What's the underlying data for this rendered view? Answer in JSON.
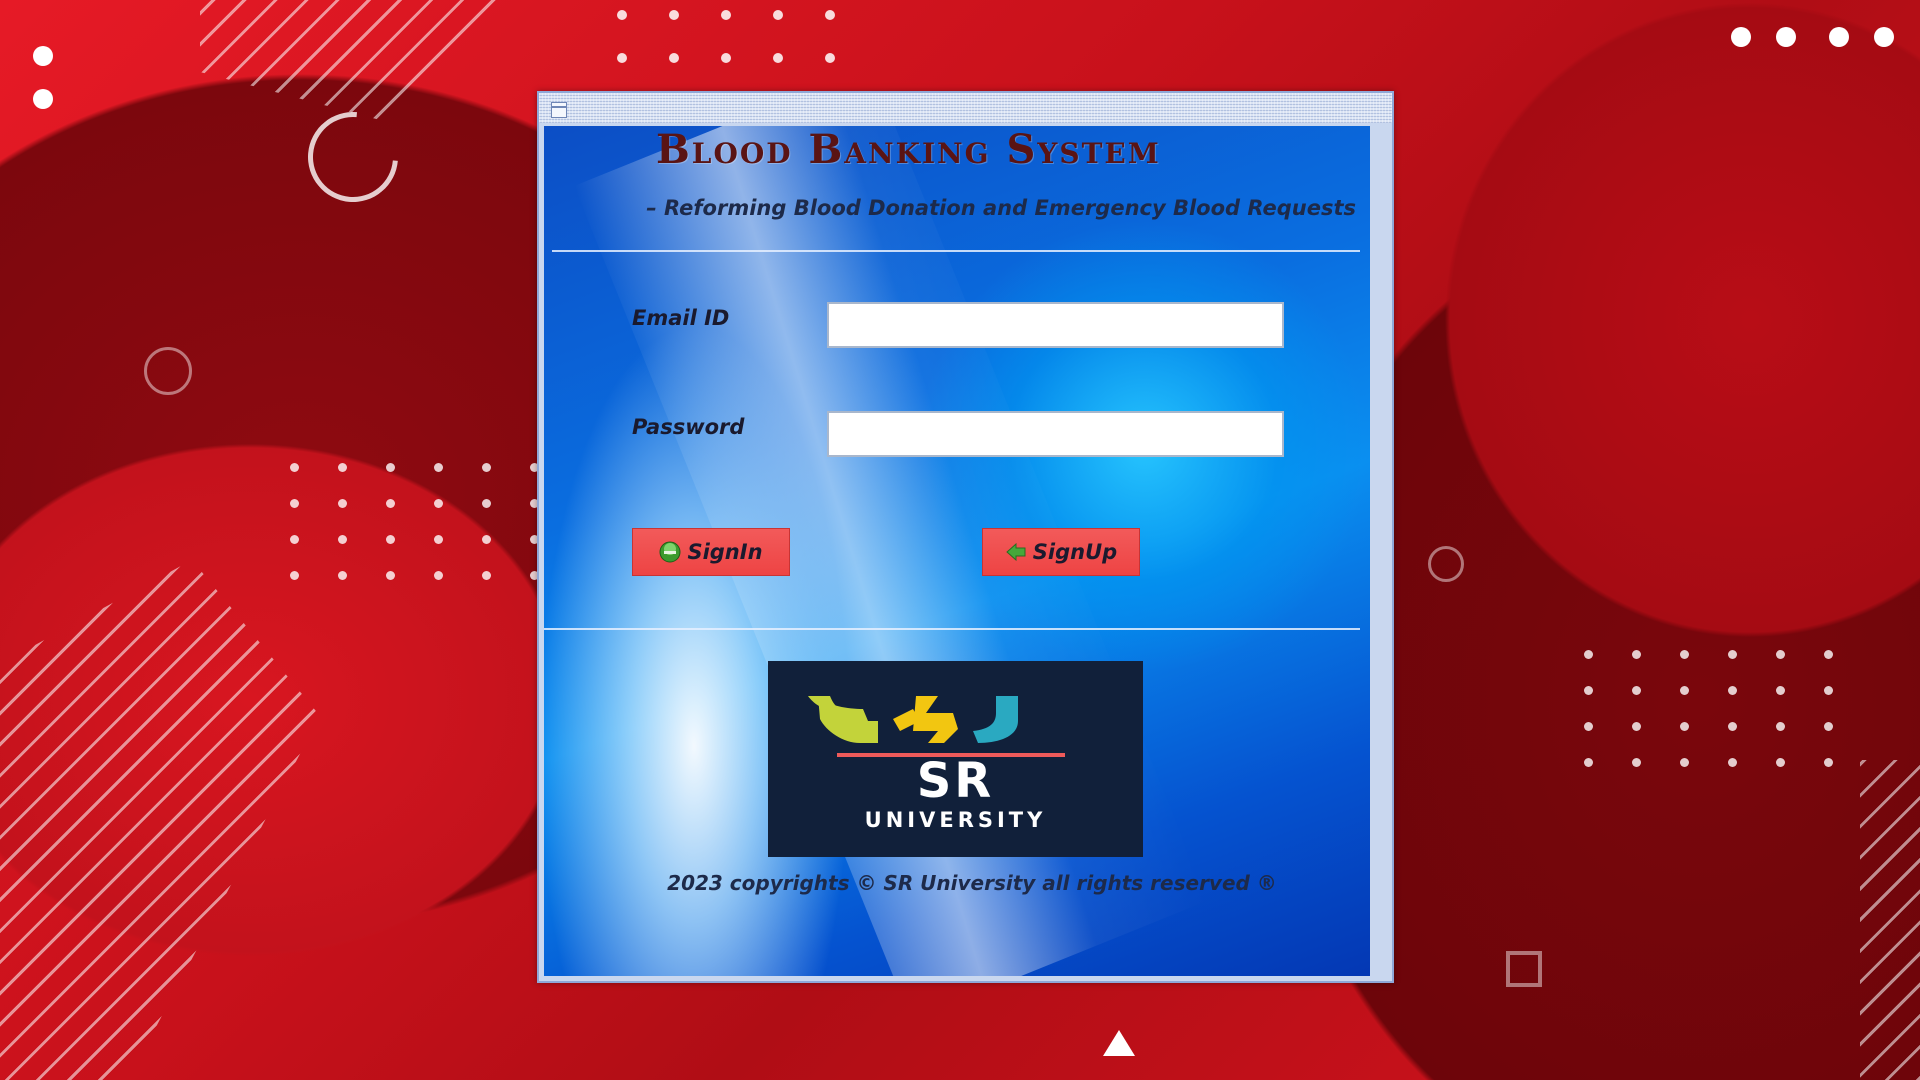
{
  "window": {
    "title": "",
    "icon": "window-icon"
  },
  "header": {
    "title": "Blood Banking System",
    "subtitle": "– Reforming Blood Donation and Emergency Blood Requests"
  },
  "form": {
    "email_label": "Email ID",
    "email_value": "",
    "email_placeholder": "",
    "password_label": "Password",
    "password_value": "",
    "password_placeholder": ""
  },
  "buttons": {
    "signin_label": "SignIn",
    "signin_icon": "green-circle-icon",
    "signup_label": "SignUp",
    "signup_icon": "green-arrow-left-icon"
  },
  "logo": {
    "name": "SR University logo",
    "line1": "SR",
    "line2": "UNIVERSITY"
  },
  "footer": {
    "copyright": "2023 copyrights © SR University all rights reserved ®"
  },
  "colors": {
    "background_red": "#c8111b",
    "button_red": "#ee4444",
    "title_maroon": "#5a1414",
    "panel_blue": "#0a6ee0"
  }
}
